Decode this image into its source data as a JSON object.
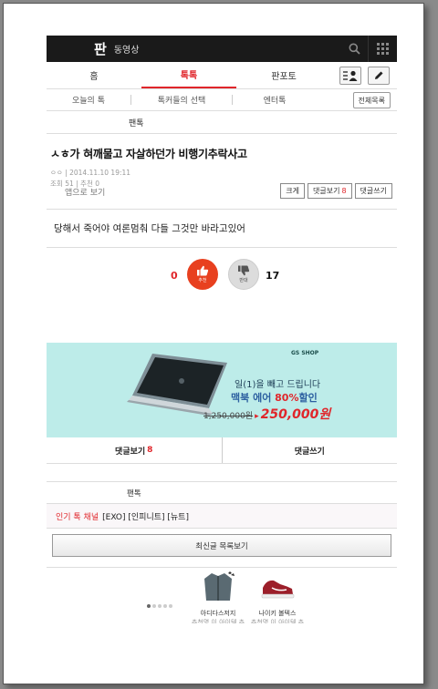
{
  "header": {
    "logo": "판",
    "sub": "동영상"
  },
  "nav": {
    "tabs": [
      {
        "label": "홈"
      },
      {
        "label": "톡톡"
      },
      {
        "label": "판포토"
      }
    ]
  },
  "subnav": {
    "items": [
      {
        "label": "오늘의 톡"
      },
      {
        "label": "톡커들의 선택"
      },
      {
        "label": "엔터톡"
      }
    ],
    "all_list": "전체목록"
  },
  "board": {
    "title": "팬톡"
  },
  "post": {
    "title": "ㅅㅎ가 혀깨물고 자살하던가 비행기추락사고",
    "author": "ㅇㅇ",
    "date": "2014.11.10 19:11",
    "views_label": "조회",
    "views": "51",
    "recommend_label": "추천",
    "recommend": "0",
    "app_view": "앱으로 보기",
    "btn_size": "크게",
    "btn_comments": "댓글보기",
    "comment_count": "8",
    "btn_write": "댓글쓰기",
    "body": "당해서 죽어야 여론멈춰 다들 그것만 바라고있어"
  },
  "votes": {
    "up": "0",
    "up_label": "추천",
    "down": "17",
    "down_label": "반대"
  },
  "ad": {
    "brand": "GS SHOP",
    "line1": "일(1)을 빼고 드립니다",
    "line2a": "맥북 에어 ",
    "line2b": "80%",
    "line2c": "할인",
    "old_price": "1,250,000원",
    "arrow": "▸",
    "new_price": "250,000원"
  },
  "comments": {
    "view": "댓글보기",
    "count": "8",
    "write": "댓글쓰기"
  },
  "board2": {
    "title": "팬톡"
  },
  "popular": {
    "label": "인기 톡 채널",
    "channels": "[EXO] [인피니트] [뉴트]"
  },
  "latest": {
    "label": "최신글 목록보기"
  },
  "products": [
    {
      "name": "아디다스저지",
      "sub": "추천명 이 아이템 추"
    },
    {
      "name": "나이키 볼텍스",
      "sub": "추천명 이 아이템 추"
    }
  ],
  "colors": {
    "accent": "#e0262b",
    "ad_bg": "#bdece9",
    "topbar": "#1a1a1a"
  }
}
